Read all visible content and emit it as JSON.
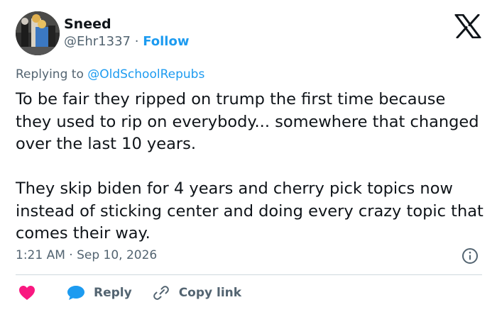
{
  "user": {
    "name": "Sneed",
    "handle": "@Ehr1337",
    "separator": "·",
    "follow_label": "Follow"
  },
  "reply_to": {
    "prefix": "Replying to",
    "mention": "@OldSchoolRepubs"
  },
  "tweet": {
    "paragraphs": [
      "To be fair they ripped on trump the first time because they used to rip on everybody... somewhere that changed over the last 10 years.",
      "They skip biden for 4 years and cherry pick topics now instead of sticking center and doing every crazy topic that comes their way."
    ],
    "timestamp": "1:21 AM · Sep 10, 2026"
  },
  "actions": {
    "reply_label": "Reply",
    "copy_label": "Copy link"
  },
  "icons": {
    "platform": "x-logo-icon",
    "info": "info-icon",
    "like": "heart-icon",
    "reply": "speech-bubble-icon",
    "copy": "link-icon"
  },
  "colors": {
    "accent": "#1d9bf0",
    "like": "#f91880",
    "text": "#0f1419",
    "muted": "#536471"
  }
}
